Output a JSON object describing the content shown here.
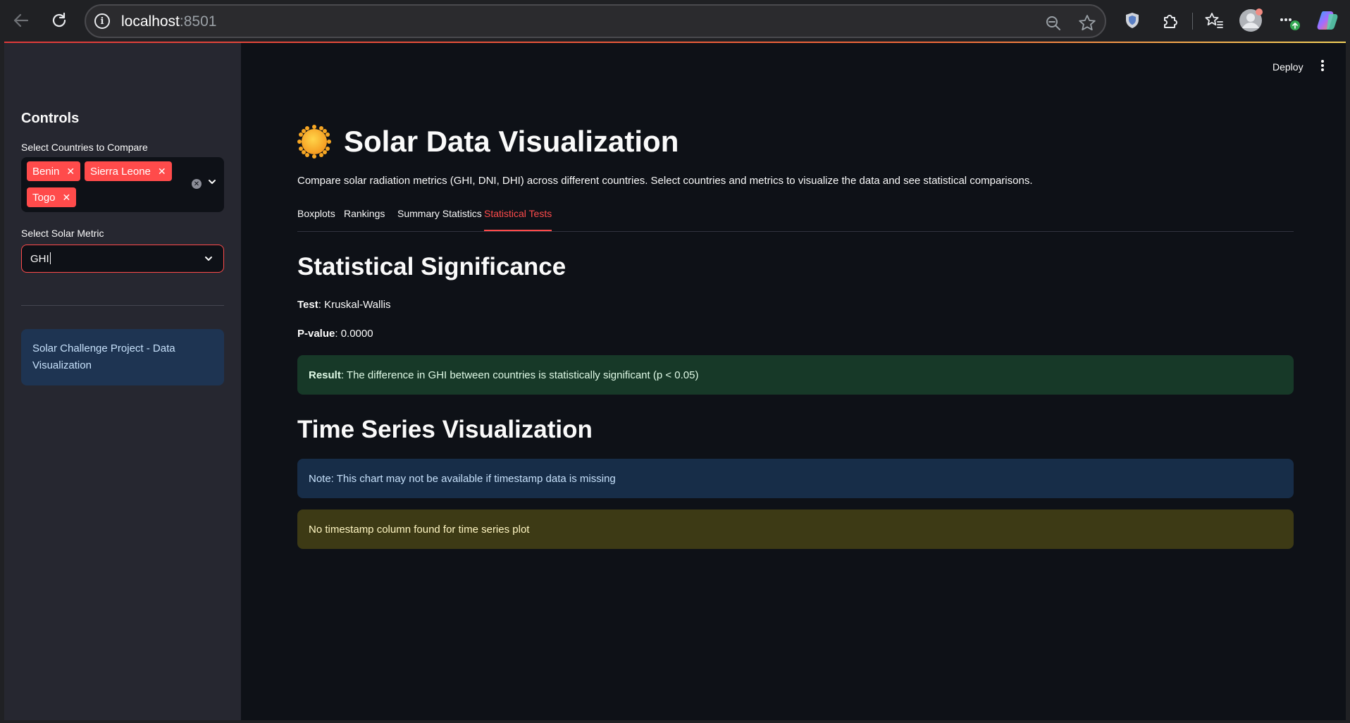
{
  "browser": {
    "url_host": "localhost",
    "url_port": ":8501"
  },
  "sidebar": {
    "title": "Controls",
    "countries_label": "Select Countries to Compare",
    "selected_countries": [
      "Benin",
      "Sierra Leone",
      "Togo"
    ],
    "metric_label": "Select Solar Metric",
    "metric_value": "GHI",
    "info_text": "Solar Challenge Project - Data Visualization"
  },
  "header": {
    "deploy_label": "Deploy"
  },
  "main": {
    "title": "Solar Data Visualization",
    "subtitle": "Compare solar radiation metrics (GHI, DNI, DHI) across different countries. Select countries and metrics to visualize the data and see statistical comparisons.",
    "tabs": [
      {
        "label": "Boxplots"
      },
      {
        "label": "Rankings"
      },
      {
        "label": "Summary Statistics"
      },
      {
        "label": "Statistical Tests",
        "active": true
      }
    ],
    "significance": {
      "heading": "Statistical Significance",
      "test_label": "Test",
      "test_value": ": Kruskal-Wallis",
      "pvalue_label": "P-value",
      "pvalue_value": ": 0.0000",
      "result_label": "Result",
      "result_text": ": The difference in GHI between countries is statistically significant (p < 0.05)"
    },
    "timeseries": {
      "heading": "Time Series Visualization",
      "note": "Note: This chart may not be available if timestamp data is missing",
      "warning": "No timestamp column found for time series plot"
    }
  },
  "colors": {
    "accent": "#ff4b4b",
    "sidebar_bg": "#262730",
    "main_bg": "#0e1117"
  }
}
